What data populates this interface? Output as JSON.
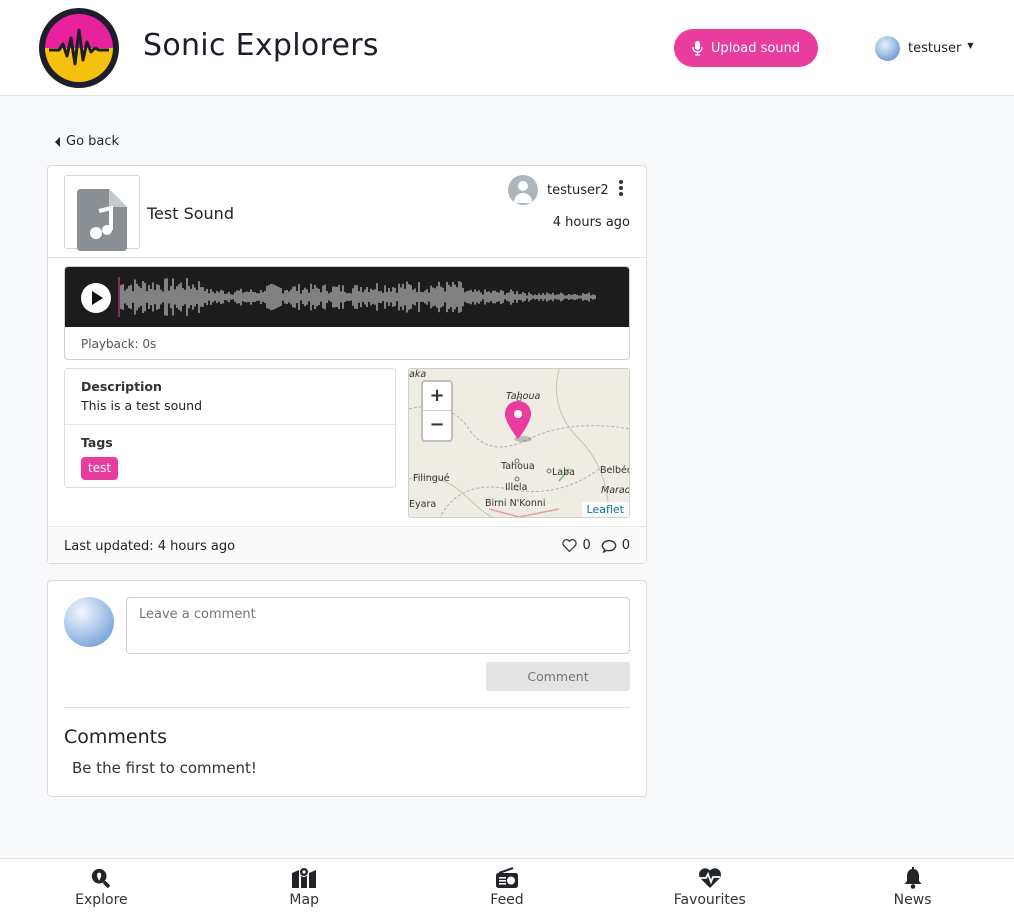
{
  "header": {
    "app_title": "Sonic Explorers",
    "upload_label": "Upload sound",
    "username": "testuser"
  },
  "nav": {
    "go_back": "Go back"
  },
  "sound": {
    "title": "Test Sound",
    "owner": "testuser2",
    "time_ago": "4 hours ago",
    "playback_label": "Playback: 0s",
    "description_label": "Description",
    "description": "This is a test sound",
    "tags_label": "Tags",
    "tags": [
      "test"
    ],
    "last_updated": "Last updated: 4 hours ago",
    "likes": "0",
    "comments_count": "0"
  },
  "map": {
    "zoom_in": "+",
    "zoom_out": "−",
    "attribution": "Leaflet",
    "places": [
      "Tahoua",
      "Tahoua",
      "Laba",
      "Belbéd",
      "Filingué",
      "Illela",
      "Birni N'Konni",
      "Eyara",
      "Maradi",
      "aka"
    ]
  },
  "comments": {
    "placeholder": "Leave a comment",
    "button_label": "Comment",
    "title": "Comments",
    "empty_text": "Be the first to comment!"
  },
  "bottom_nav": {
    "items": [
      {
        "label": "Explore",
        "icon": "search-location-icon"
      },
      {
        "label": "Map",
        "icon": "map-icon"
      },
      {
        "label": "Feed",
        "icon": "radio-icon"
      },
      {
        "label": "Favourites",
        "icon": "heartbeat-icon"
      },
      {
        "label": "News",
        "icon": "bell-icon"
      }
    ]
  },
  "colors": {
    "accent": "#e83c9e",
    "logo_yellow": "#f4c20d",
    "logo_pink": "#e8219d",
    "waveform_bg": "#1c1c1c"
  }
}
